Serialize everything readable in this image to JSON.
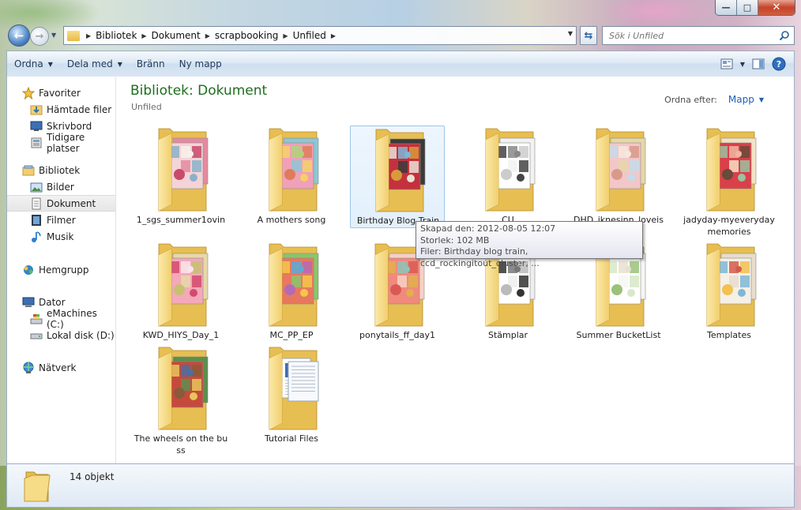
{
  "window": {
    "caption_buttons": [
      "minimize",
      "maximize",
      "close"
    ]
  },
  "nav": {
    "breadcrumbs": [
      "Bibliotek",
      "Dokument",
      "scrapbooking",
      "Unfiled"
    ],
    "search_placeholder": "Sök i Unfiled"
  },
  "toolbar": {
    "organize": "Ordna",
    "share": "Dela med",
    "burn": "Bränn",
    "new_folder": "Ny mapp"
  },
  "sidebar": {
    "favorites_label": "Favoriter",
    "favorites": [
      "Hämtade filer",
      "Skrivbord",
      "Tidigare platser"
    ],
    "libraries_label": "Bibliotek",
    "libraries": [
      "Bilder",
      "Dokument",
      "Filmer",
      "Musik"
    ],
    "homegroup_label": "Hemgrupp",
    "computer_label": "Dator",
    "computer": [
      "eMachines (C:)",
      "Lokal disk (D:)"
    ],
    "network_label": "Nätverk",
    "selected": "Dokument"
  },
  "content": {
    "title": "Bibliotek: Dokument",
    "subtitle": "Unfiled",
    "arrange_label": "Ordna efter:",
    "arrange_value": "Mapp"
  },
  "folders": [
    {
      "label": "1_sgs_summer1ovin",
      "theme": "pink-flower"
    },
    {
      "label": "A mothers song",
      "theme": "colorful-scraps"
    },
    {
      "label": "Birthday Blog Train",
      "theme": "red-birthday",
      "selected": true
    },
    {
      "label": "CU",
      "theme": "wordart"
    },
    {
      "label": "DHD_iknesinn_loveis",
      "theme": "pastel-papers"
    },
    {
      "label": "jadyday-myeverydaymemories",
      "theme": "red-flowers"
    },
    {
      "label": "KWD_HIYS_Day_1",
      "theme": "pink-papers"
    },
    {
      "label": "MC_PP_EP",
      "theme": "mixed-elements"
    },
    {
      "label": "ponytails_ff_day1",
      "theme": "coral-papers"
    },
    {
      "label": "Stämplar",
      "theme": "stamps"
    },
    {
      "label": "Summer BucketList",
      "theme": "white-papers"
    },
    {
      "label": "Templates",
      "theme": "template"
    },
    {
      "label": "The wheels on the buss",
      "theme": "bus-kit"
    },
    {
      "label": "Tutorial Files",
      "theme": "documents"
    }
  ],
  "tooltip": {
    "created": "Skapad den: 2012-08-05 12:07",
    "size": "Storlek: 102 MB",
    "files": "Filer: Birthday blog train, ccd_rockingitout_cluster, ..."
  },
  "details": {
    "count": "14 objekt"
  },
  "colors": {
    "title_green": "#1e6e1e",
    "link_blue": "#1e5eb5",
    "toolbar_text": "#1e395b",
    "folder_yellow": "#f2cf6f"
  }
}
